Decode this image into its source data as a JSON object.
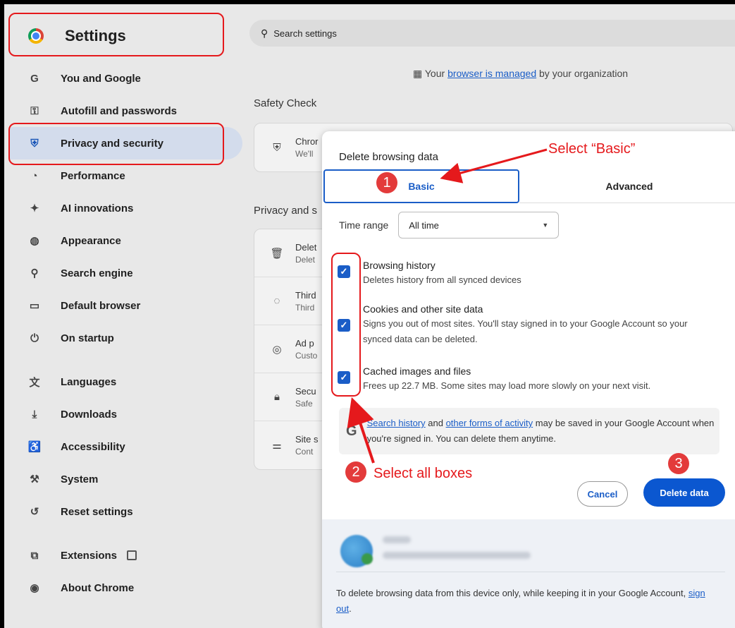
{
  "sidebar": {
    "title": "Settings",
    "items": [
      {
        "label": "You and Google",
        "icon": "G"
      },
      {
        "label": "Autofill and passwords",
        "icon": "⚿"
      },
      {
        "label": "Privacy and security",
        "icon": "⛨"
      },
      {
        "label": "Performance",
        "icon": "◔"
      },
      {
        "label": "AI innovations",
        "icon": "✦"
      },
      {
        "label": "Appearance",
        "icon": "◍"
      },
      {
        "label": "Search engine",
        "icon": "⚲"
      },
      {
        "label": "Default browser",
        "icon": "▭"
      },
      {
        "label": "On startup",
        "icon": "⏻"
      },
      {
        "label": "Languages",
        "icon": "文"
      },
      {
        "label": "Downloads",
        "icon": "⤓"
      },
      {
        "label": "Accessibility",
        "icon": "♿"
      },
      {
        "label": "System",
        "icon": "⚒"
      },
      {
        "label": "Reset settings",
        "icon": "↺"
      },
      {
        "label": "Extensions",
        "icon": "⧉"
      },
      {
        "label": "About Chrome",
        "icon": "◉"
      }
    ]
  },
  "main": {
    "search_placeholder": "Search settings",
    "managed_prefix": "Your ",
    "managed_link": "browser is managed",
    "managed_suffix": " by your organization",
    "safety_check": "Safety Check",
    "safety_row": {
      "title": "Chror",
      "sub": "We'll"
    },
    "privacy_label": "Privacy and s",
    "privacy_rows": [
      {
        "title": "Delet",
        "sub": "Delet"
      },
      {
        "title": "Third",
        "sub": "Third"
      },
      {
        "title": "Ad p",
        "sub": "Custo"
      },
      {
        "title": "Secu",
        "sub": "Safe"
      },
      {
        "title": "Site s",
        "sub": "Cont"
      }
    ]
  },
  "dialog": {
    "title": "Delete browsing data",
    "tabs": {
      "basic": "Basic",
      "advanced": "Advanced"
    },
    "time_range_label": "Time range",
    "time_range_value": "All time",
    "options": [
      {
        "title": "Browsing history",
        "desc": "Deletes history from all synced devices",
        "checked": true
      },
      {
        "title": "Cookies and other site data",
        "desc": "Signs you out of most sites. You'll stay signed in to your Google Account so your synced data can be deleted.",
        "checked": true
      },
      {
        "title": "Cached images and files",
        "desc": "Frees up 22.7 MB. Some sites may load more slowly on your next visit.",
        "checked": true
      }
    ],
    "google_note": {
      "link1": "Search history",
      "mid": " and ",
      "link2": "other forms of activity",
      "rest": " may be saved in your Google Account when you're signed in. You can delete them anytime."
    },
    "cancel": "Cancel",
    "delete": "Delete data",
    "account_note_prefix": "To delete browsing data from this device only, while keeping it in your Google Account, ",
    "account_note_link": "sign out",
    "account_note_suffix": "."
  },
  "annotations": {
    "step1": "1",
    "step2": "2",
    "step3": "3",
    "select_basic": "Select “Basic”",
    "select_all": "Select all boxes",
    "accent_color": "#e5191c"
  }
}
